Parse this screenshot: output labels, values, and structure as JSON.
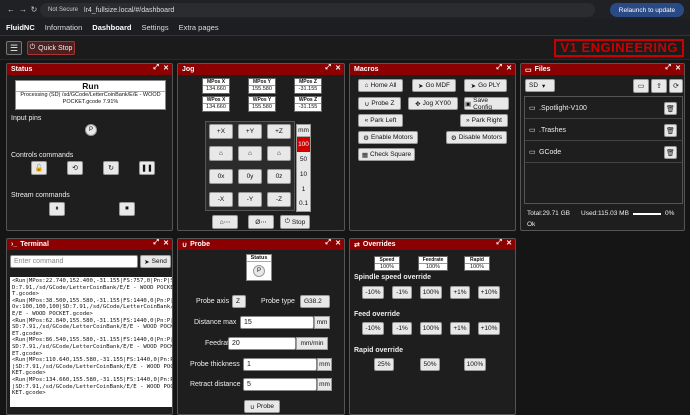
{
  "browser": {
    "security": "Not Secure",
    "url": "lr4_fullsize.local/#/dashboard",
    "relaunch": "Relaunch to update"
  },
  "nav": {
    "brand": "FluidNC",
    "items": [
      "Information",
      "Dashboard",
      "Settings",
      "Extra pages"
    ],
    "active": "Dashboard"
  },
  "toolbar": {
    "quick_stop": "Quick Stop",
    "logo": "V1 ENGINEERING"
  },
  "status": {
    "title": "Status",
    "state": "Run",
    "message": "Processing (SD) /sd/GCode/LetterCoinBank/E/E - WOOD POCKET.gcode 7.91%",
    "input_pins": "Input pins",
    "pin": "P",
    "controls": "Controls commands",
    "stream": "Stream commands"
  },
  "jog": {
    "title": "Jog",
    "mpos": [
      {
        "h": "MPos X",
        "v": "134.660"
      },
      {
        "h": "MPos Y",
        "v": "155.580"
      },
      {
        "h": "MPos Z",
        "v": "-31.155"
      }
    ],
    "wpos": [
      {
        "h": "WPos X",
        "v": "134.660"
      },
      {
        "h": "WPos Y",
        "v": "155.580"
      },
      {
        "h": "WPos Z",
        "v": "-31.155"
      }
    ],
    "plus": [
      "+X",
      "+Y",
      "+Z"
    ],
    "minus": [
      "-X",
      "-Y",
      "-Z"
    ],
    "zero": [
      "0x",
      "0y",
      "0z"
    ],
    "steps": [
      "mm",
      "100",
      "50",
      "10",
      "1",
      "0.1"
    ],
    "selected_step": "100",
    "stop": "Stop"
  },
  "macros": {
    "title": "Macros",
    "items": [
      "Home All",
      "Go MDF",
      "Go PLY",
      "Probe Z",
      "Jog XY00",
      "Save Config",
      "Park Left",
      "Park Right",
      "Enable Motors",
      "Disable Motors",
      "Check Square"
    ]
  },
  "files": {
    "title": "Files",
    "source": "SD",
    "entries": [
      ".Spotlight-V100",
      ".Trashes",
      "GCode"
    ],
    "total": "Total:29.71 GB",
    "used": "Used:115.03 MB",
    "pct": "0%",
    "status": "Ok"
  },
  "terminal": {
    "title": "Terminal",
    "placeholder": "Enter command",
    "send": "Send",
    "lines": "<Run|MPos:22.740,152.400,-31.155|FS:757,0|Pn:P|SD:7.91,/sd/GCode/LetterCoinBank/E/E - WOOD POCKET.gcode>\n<Run|MPos:38.500,155.580,-31.155|FS:1440,0|Pn:P|Ov:100,100,100|SD:7.91,/sd/GCode/LetterCoinBank/E/E - WOOD POCKET.gcode>\n<Run|MPos:62.840,155.580,-31.155|FS:1440,0|Pn:P|SD:7.91,/sd/GCode/LetterCoinBank/E/E - WOOD POCKET.gcode>\n<Run|MPos:86.540,155.580,-31.155|FS:1440,0|Pn:P|SD:7.91,/sd/GCode/LetterCoinBank/E/E - WOOD POCKET.gcode>\n<Run|MPos:110.640,155.580,-31.155|FS:1440,0|Pn:P|SD:7.91,/sd/GCode/LetterCoinBank/E/E - WOOD POCKET.gcode>\n<Run|MPos:134.660,155.580,-31.155|FS:1440,0|Pn:P|SD:7.91,/sd/GCode/LetterCoinBank/E/E - WOOD POCKET.gcode>"
  },
  "probe": {
    "title": "Probe",
    "status": "Status",
    "pin": "P",
    "axis_label": "Probe axis",
    "axis": "Z",
    "type_label": "Probe type",
    "type": "G38.2",
    "dist_label": "Distance max",
    "dist": "15",
    "dist_unit": "mm",
    "feed_label": "Feedrate",
    "feed": "20",
    "feed_unit": "mm/min",
    "thick_label": "Probe thickness",
    "thick": "1",
    "thick_unit": "mm",
    "retract_label": "Retract distance",
    "retract": "5",
    "retract_unit": "mm",
    "button": "Probe"
  },
  "overrides": {
    "title": "Overrides",
    "speed": {
      "h": "Speed",
      "v": "100%"
    },
    "feedrate": {
      "h": "Feedrate",
      "v": "100%"
    },
    "rapid": {
      "h": "Rapid",
      "v": "100%"
    },
    "spindle_label": "Spindle speed override",
    "feed_label": "Feed override",
    "rapid_label": "Rapid override",
    "adj": [
      "-10%",
      "-1%",
      "100%",
      "+1%",
      "+10%"
    ],
    "rapid_opts": [
      "25%",
      "50%",
      "100%"
    ]
  },
  "colors": {
    "accent": "#8b0000",
    "logo": "#cc0000"
  }
}
